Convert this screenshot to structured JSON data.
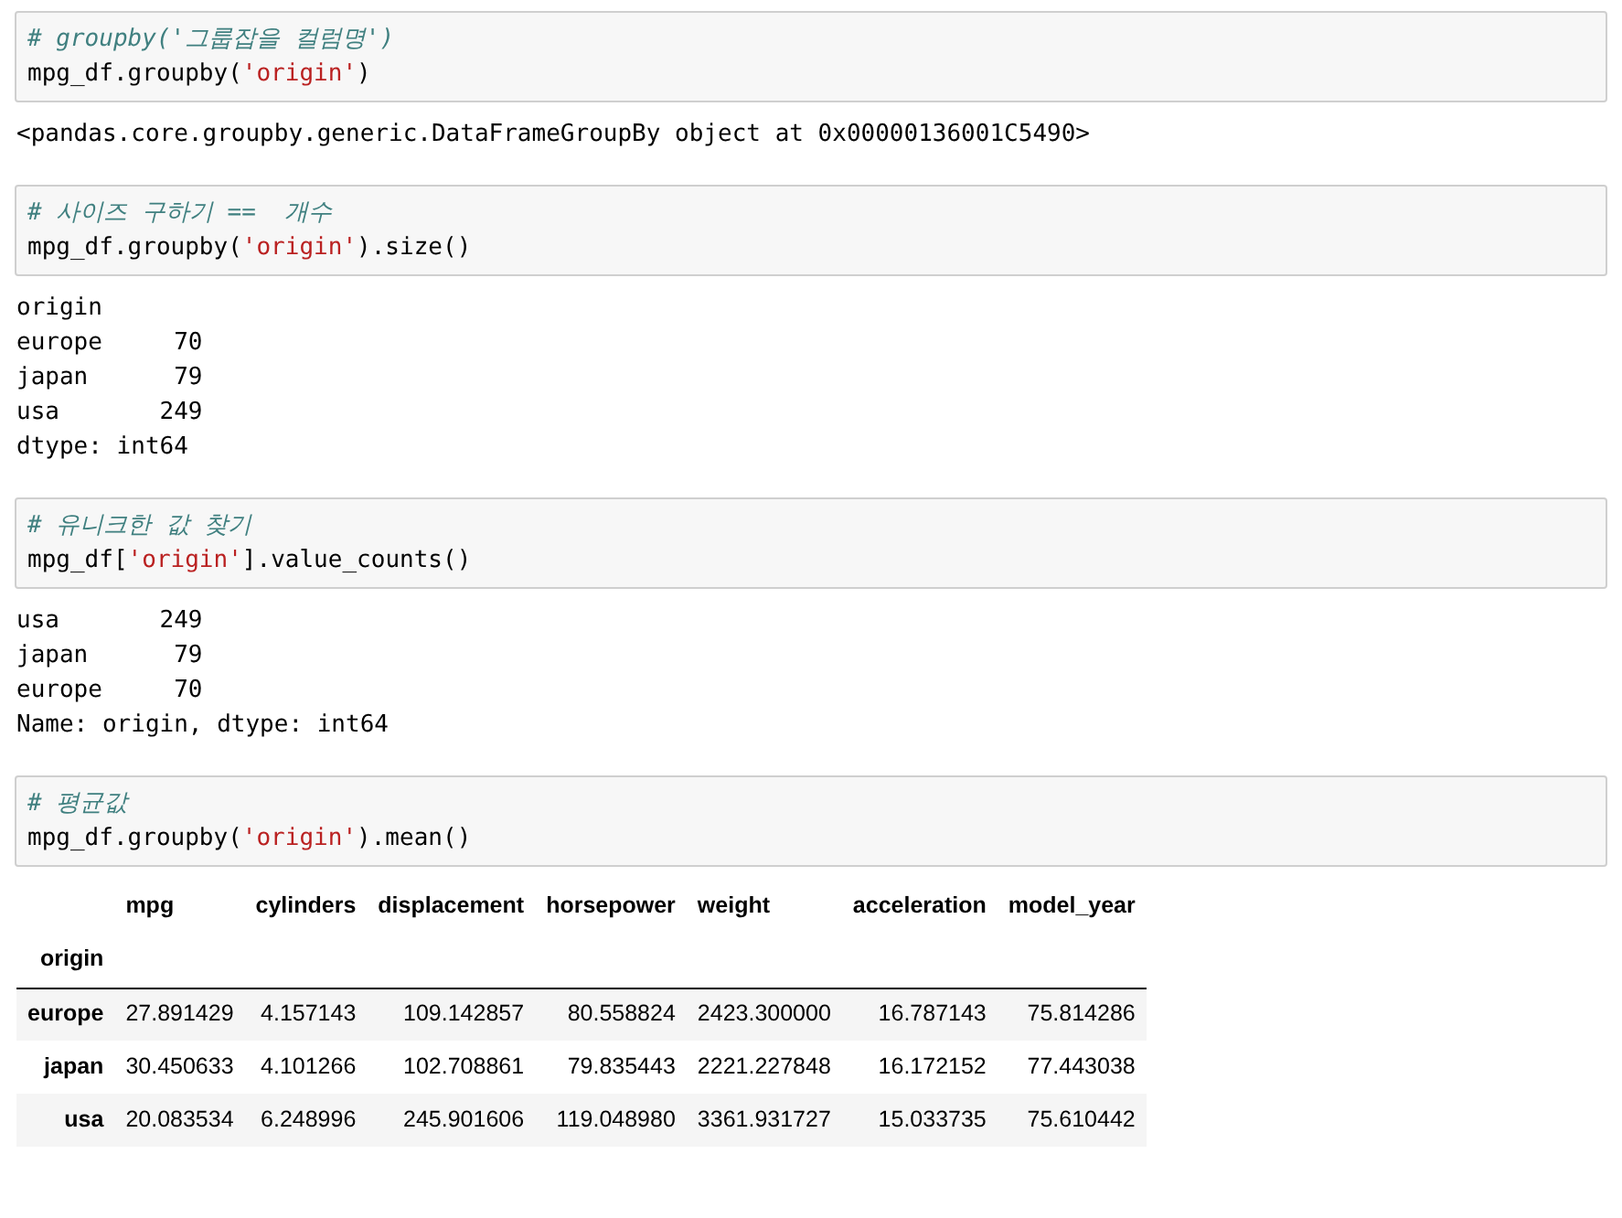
{
  "cells": [
    {
      "input": [
        [
          {
            "kind": "comment",
            "text": "# groupby('그룹잡을 컬럼명')"
          }
        ],
        [
          {
            "kind": "code",
            "text": "mpg_df.groupby("
          },
          {
            "kind": "string",
            "text": "'origin'"
          },
          {
            "kind": "code",
            "text": ")"
          }
        ]
      ],
      "output": {
        "kind": "text",
        "lines": [
          "<pandas.core.groupby.generic.DataFrameGroupBy object at 0x00000136001C5490>"
        ]
      }
    },
    {
      "input": [
        [
          {
            "kind": "comment",
            "text": "# 사이즈 구하기 ==  개수"
          }
        ],
        [
          {
            "kind": "code",
            "text": "mpg_df.groupby("
          },
          {
            "kind": "string",
            "text": "'origin'"
          },
          {
            "kind": "code",
            "text": ").size()"
          }
        ]
      ],
      "output": {
        "kind": "text",
        "lines": [
          "origin",
          "europe     70",
          "japan      79",
          "usa       249",
          "dtype: int64"
        ]
      }
    },
    {
      "input": [
        [
          {
            "kind": "comment",
            "text": "# 유니크한 값 찾기"
          }
        ],
        [
          {
            "kind": "code",
            "text": "mpg_df["
          },
          {
            "kind": "string",
            "text": "'origin'"
          },
          {
            "kind": "code",
            "text": "].value_counts()"
          }
        ]
      ],
      "output": {
        "kind": "text",
        "lines": [
          "usa       249",
          "japan      79",
          "europe     70",
          "Name: origin, dtype: int64"
        ]
      }
    },
    {
      "input": [
        [
          {
            "kind": "comment",
            "text": "# 평균값"
          }
        ],
        [
          {
            "kind": "code",
            "text": "mpg_df.groupby("
          },
          {
            "kind": "string",
            "text": "'origin'"
          },
          {
            "kind": "code",
            "text": ").mean()"
          }
        ]
      ],
      "output": {
        "kind": "table",
        "columns": [
          "mpg",
          "cylinders",
          "displacement",
          "horsepower",
          "weight",
          "acceleration",
          "model_year"
        ],
        "index_name": "origin",
        "rows": [
          {
            "index": "europe",
            "values": [
              "27.891429",
              "4.157143",
              "109.142857",
              "80.558824",
              "2423.300000",
              "16.787143",
              "75.814286"
            ]
          },
          {
            "index": "japan",
            "values": [
              "30.450633",
              "4.101266",
              "102.708861",
              "79.835443",
              "2221.227848",
              "16.172152",
              "77.443038"
            ]
          },
          {
            "index": "usa",
            "values": [
              "20.083534",
              "6.248996",
              "245.901606",
              "119.048980",
              "3361.931727",
              "15.033735",
              "75.610442"
            ]
          }
        ]
      }
    }
  ]
}
